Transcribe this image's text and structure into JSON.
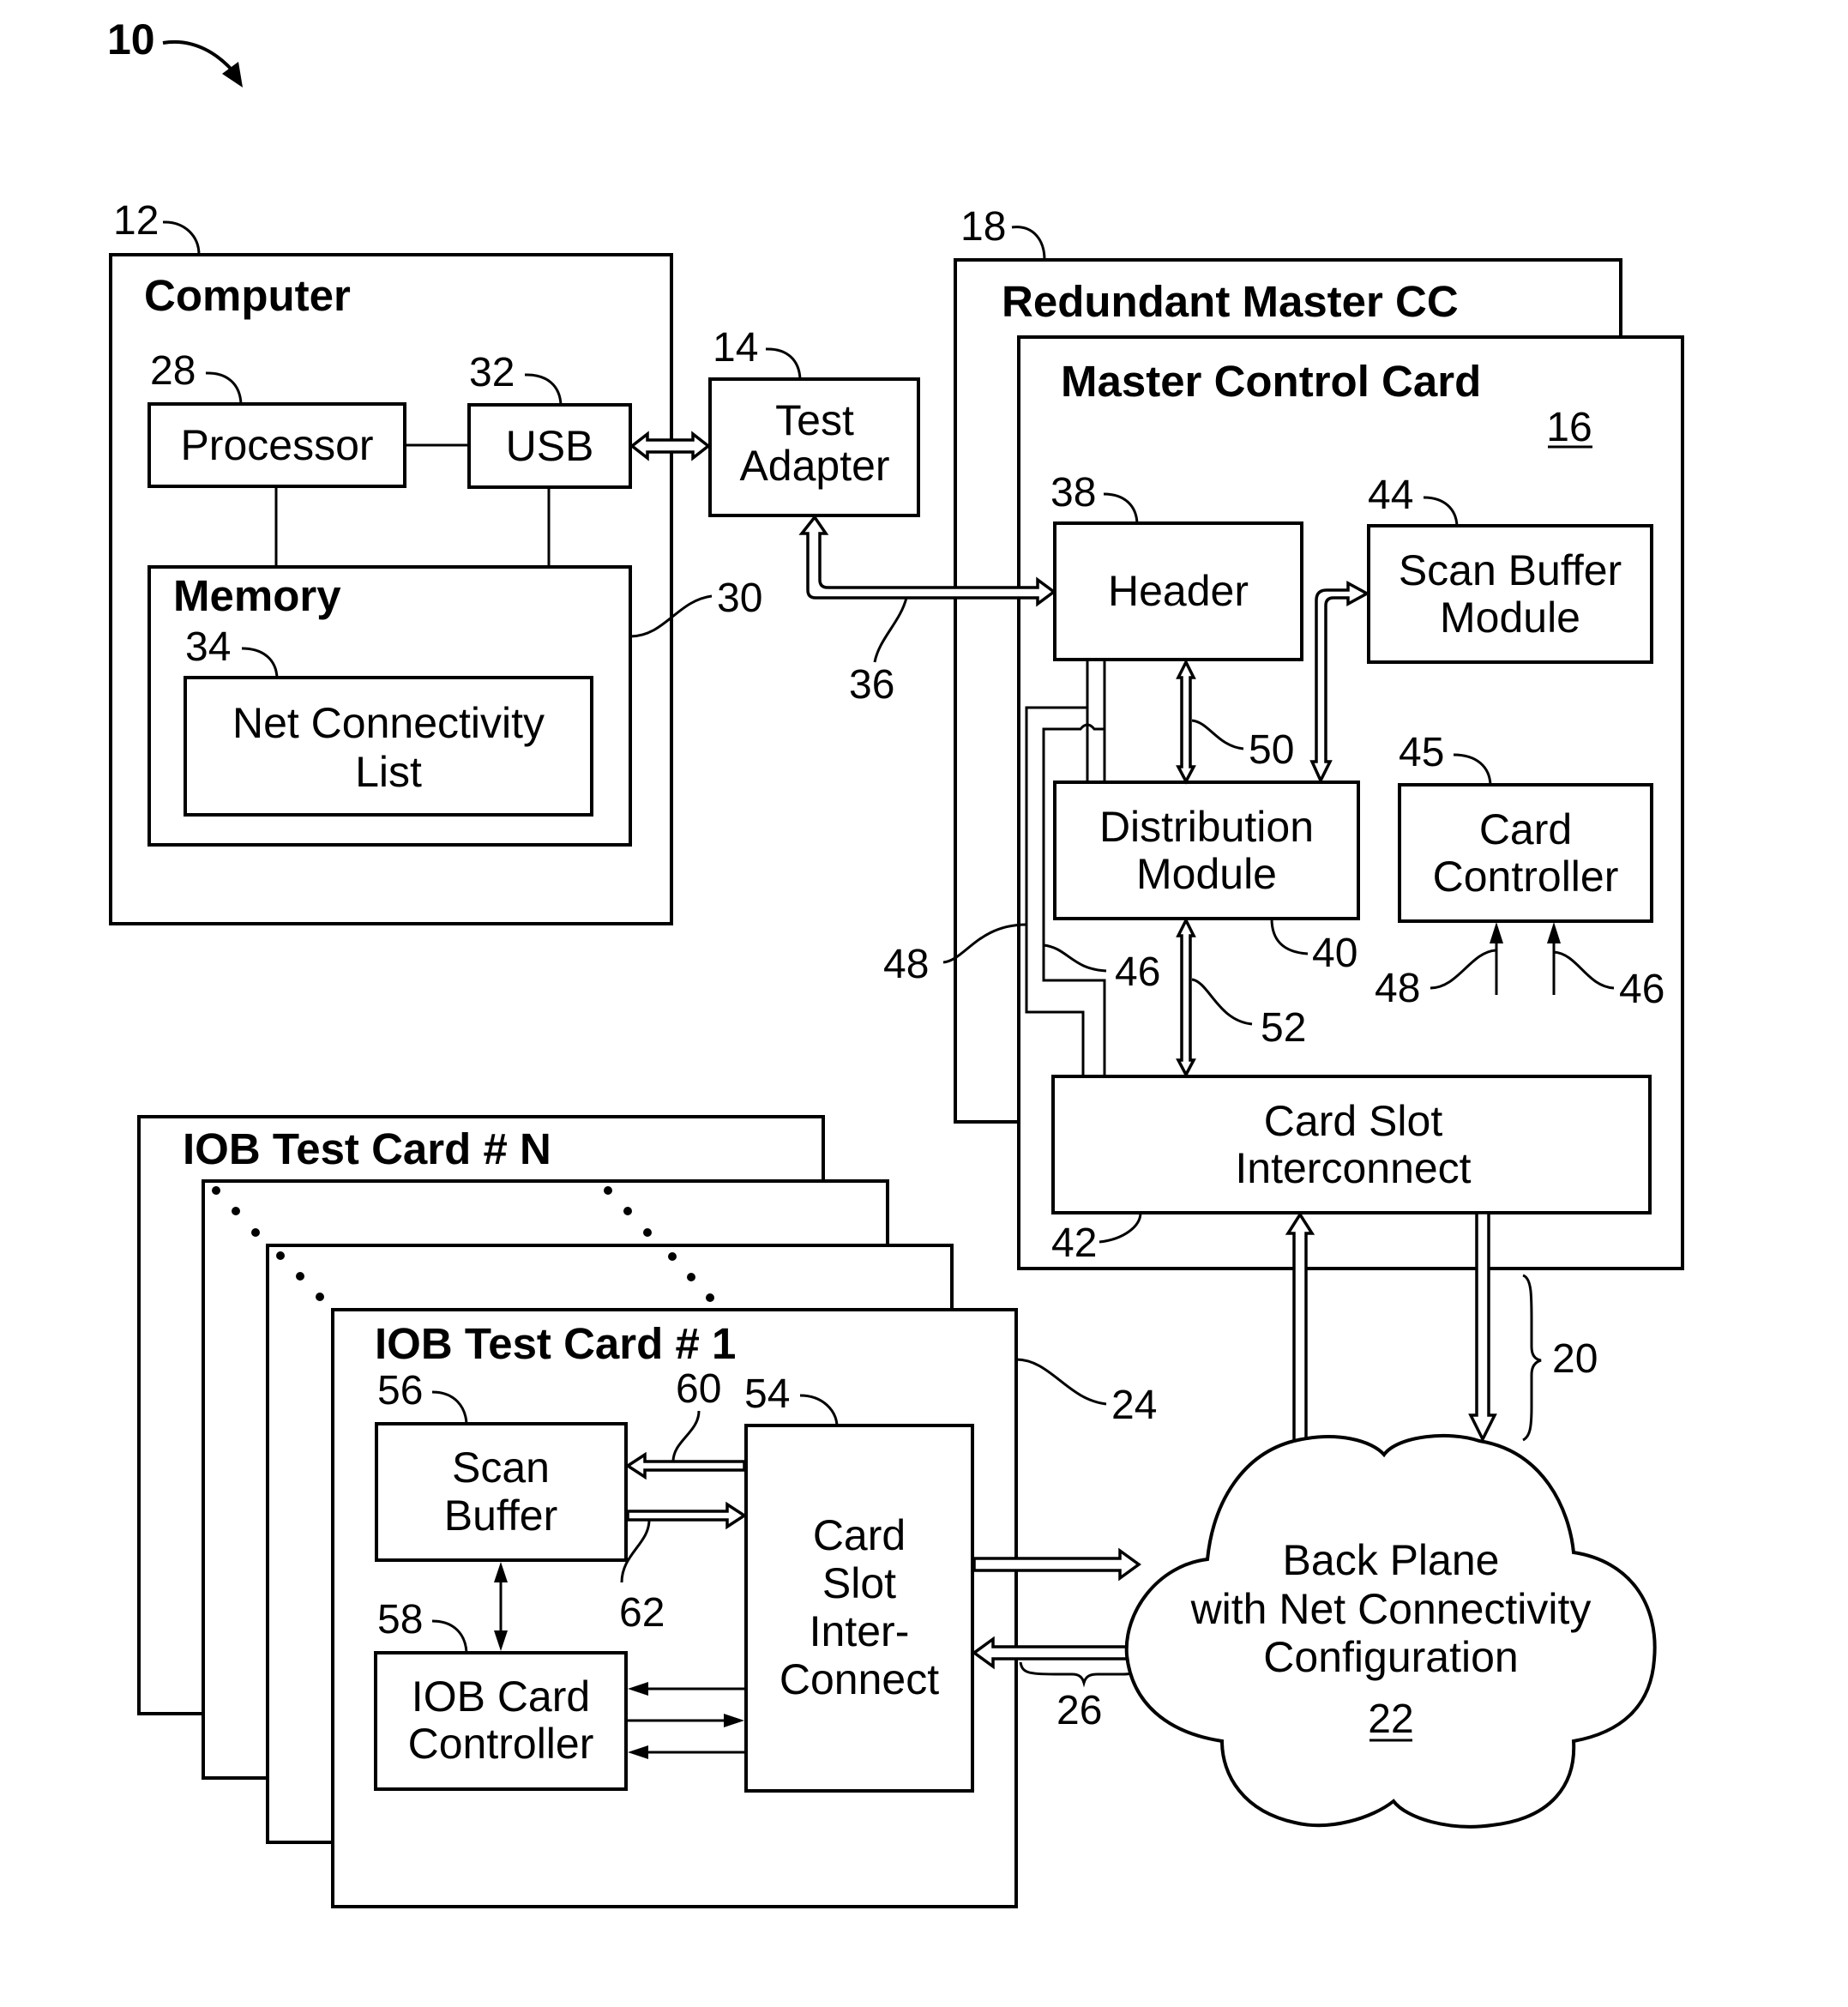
{
  "figure": {
    "ref": "10",
    "colors": {
      "ink": "#000000",
      "paper": "#ffffff"
    }
  },
  "computer": {
    "ref": "12",
    "title": "Computer",
    "processor": {
      "ref": "28",
      "label": "Processor"
    },
    "usb": {
      "ref": "32",
      "label": "USB"
    },
    "memory": {
      "ref": "30",
      "title": "Memory"
    },
    "net_list": {
      "ref": "34",
      "lines": [
        "Net Connectivity",
        "List"
      ]
    }
  },
  "test_adapter": {
    "ref": "14",
    "lines": [
      "Test",
      "Adapter"
    ]
  },
  "adapter_bus": {
    "ref": "36"
  },
  "redundant_master": {
    "ref": "18",
    "title": "Redundant Master CC"
  },
  "master_card": {
    "ref": "16",
    "title": "Master Control Card",
    "header": {
      "ref": "38",
      "label": "Header"
    },
    "scan_buffer_module": {
      "ref": "44",
      "lines": [
        "Scan Buffer",
        "Module"
      ]
    },
    "distribution_module": {
      "ref": "40",
      "lines": [
        "Distribution",
        "Module"
      ]
    },
    "card_controller": {
      "ref": "45",
      "lines": [
        "Card",
        "Controller"
      ]
    },
    "card_slot_interconnect": {
      "ref": "42",
      "lines": [
        "Card Slot",
        "Interconnect"
      ]
    },
    "bus_header_dist": {
      "ref": "50"
    },
    "bus_dist_csi": {
      "ref": "52"
    },
    "signal_a": {
      "ref": "48"
    },
    "signal_b": {
      "ref": "46"
    }
  },
  "master_bus": {
    "ref": "20"
  },
  "iob_cards": {
    "ref": "24",
    "back_title": "IOB Test Card # N",
    "front_title": "IOB Test Card # 1",
    "scan_buffer": {
      "ref": "56",
      "lines": [
        "Scan",
        "Buffer"
      ]
    },
    "iob_controller": {
      "ref": "58",
      "lines": [
        "IOB Card",
        "Controller"
      ]
    },
    "card_slot_interconnect": {
      "ref": "54",
      "lines": [
        "Card",
        "Slot",
        "Inter-",
        "Connect"
      ]
    },
    "bus_in": {
      "ref": "60"
    },
    "bus_out": {
      "ref": "62"
    }
  },
  "iob_bus": {
    "ref": "26"
  },
  "backplane": {
    "ref": "22",
    "lines": [
      "Back Plane",
      "with Net Connectivity",
      "Configuration"
    ]
  }
}
